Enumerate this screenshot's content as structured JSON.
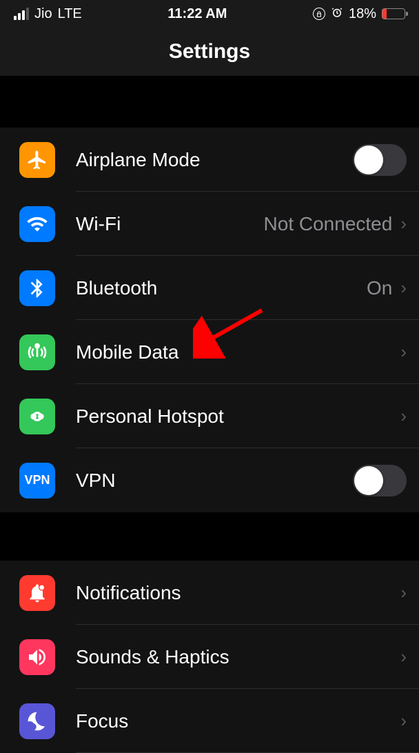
{
  "status_bar": {
    "carrier": "Jio",
    "network_type": "LTE",
    "time": "11:22 AM",
    "battery_percent": "18%"
  },
  "header": {
    "title": "Settings"
  },
  "groups": [
    {
      "rows": [
        {
          "id": "airplane",
          "label": "Airplane Mode",
          "value": "",
          "type": "toggle",
          "toggle": false,
          "icon_color": "icon-orange"
        },
        {
          "id": "wifi",
          "label": "Wi-Fi",
          "value": "Not Connected",
          "type": "nav",
          "icon_color": "icon-blue"
        },
        {
          "id": "bluetooth",
          "label": "Bluetooth",
          "value": "On",
          "type": "nav",
          "icon_color": "icon-blue"
        },
        {
          "id": "mobiledata",
          "label": "Mobile Data",
          "value": "",
          "type": "nav",
          "icon_color": "icon-green"
        },
        {
          "id": "hotspot",
          "label": "Personal Hotspot",
          "value": "",
          "type": "nav",
          "icon_color": "icon-green"
        },
        {
          "id": "vpn",
          "label": "VPN",
          "value": "",
          "type": "toggle",
          "toggle": false,
          "icon_color": "icon-blue"
        }
      ]
    },
    {
      "rows": [
        {
          "id": "notifications",
          "label": "Notifications",
          "value": "",
          "type": "nav",
          "icon_color": "icon-red"
        },
        {
          "id": "sounds",
          "label": "Sounds & Haptics",
          "value": "",
          "type": "nav",
          "icon_color": "icon-pink"
        },
        {
          "id": "focus",
          "label": "Focus",
          "value": "",
          "type": "nav",
          "icon_color": "icon-indigo"
        }
      ]
    }
  ]
}
